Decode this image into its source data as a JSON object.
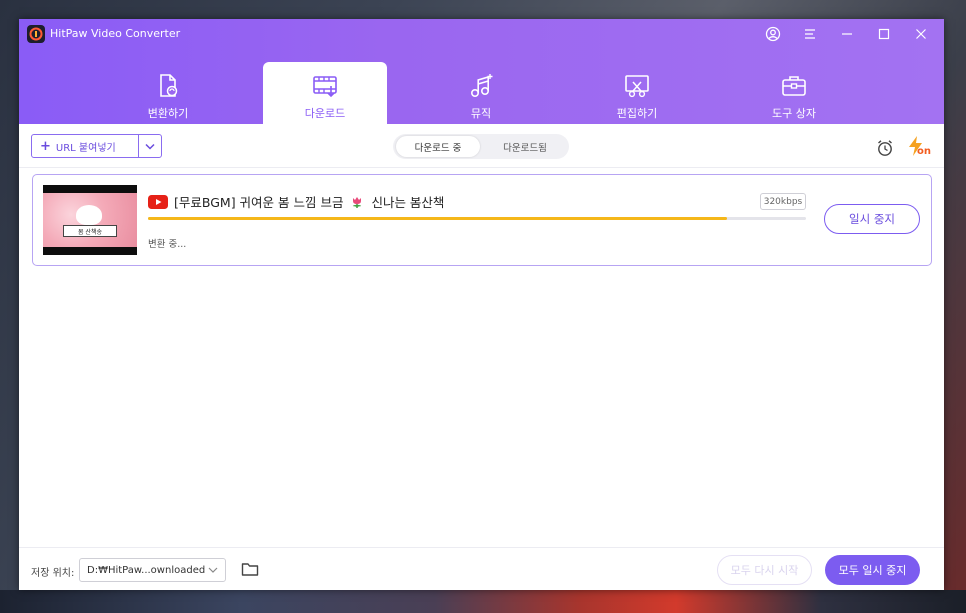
{
  "window": {
    "title": "HitPaw Video Converter"
  },
  "tabs": [
    {
      "label": "변환하기",
      "icon": "convert-icon"
    },
    {
      "label": "다운로드",
      "icon": "download-film-icon",
      "active": true
    },
    {
      "label": "뮤직",
      "icon": "music-icon"
    },
    {
      "label": "편집하기",
      "icon": "edit-icon"
    },
    {
      "label": "도구 상자",
      "icon": "toolbox-icon"
    }
  ],
  "toolbar": {
    "url_button_label": "URL 붙여넣기",
    "segments": [
      "다운로드 중",
      "다운로드됨"
    ],
    "active_segment": "다운로드 중",
    "turbo_label": "on"
  },
  "downloads": [
    {
      "title_part1": "[무료BGM] 귀여운 봄 느낌 브금",
      "title_part2": "신나는 봄산책",
      "thumbnail_text": "봄 산책송",
      "bitrate": "320kbps",
      "progress": 0.88,
      "status": "변환 중...",
      "action_label": "일시 중지"
    }
  ],
  "footer": {
    "save_location_label": "저장 위치:",
    "save_path": "D:₩HitPaw...ownloaded",
    "resume_all_label": "모두 다시 시작",
    "pause_all_label": "모두 일시 중지"
  },
  "colors": {
    "accent": "#8a5cf6",
    "progress": "#f5b719",
    "youtube": "#e62117",
    "turbo": "#f25c1f"
  }
}
